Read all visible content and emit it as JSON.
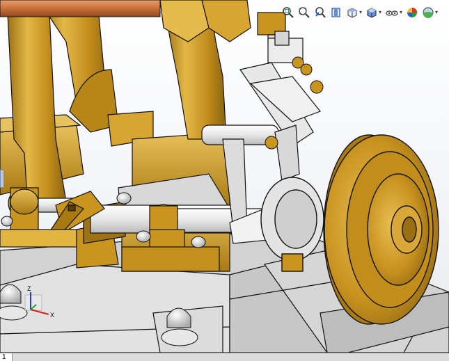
{
  "hud": {
    "tools": [
      {
        "name": "zoom-to-fit-icon"
      },
      {
        "name": "zoom-to-area-icon"
      },
      {
        "name": "previous-view-icon"
      },
      {
        "name": "section-view-icon"
      },
      {
        "name": "view-orientation-icon",
        "dropdown": true
      },
      {
        "name": "display-style-icon",
        "dropdown": true
      },
      {
        "name": "hide-show-items-icon",
        "dropdown": true
      },
      {
        "name": "edit-appearance-icon"
      },
      {
        "name": "apply-scene-icon",
        "dropdown": true
      }
    ]
  },
  "triad": {
    "z_label": "Z",
    "x_label": "X",
    "y_label": ""
  },
  "status": {
    "sheet_tab": "1"
  },
  "colors": {
    "brass": "#c9951e",
    "brass_dark": "#8a6410",
    "brass_light": "#e8c05a",
    "steel": "#e4e4e4",
    "steel_dark": "#9a9a9a",
    "copper": "#c9703a",
    "background_top": "#ffffff"
  }
}
